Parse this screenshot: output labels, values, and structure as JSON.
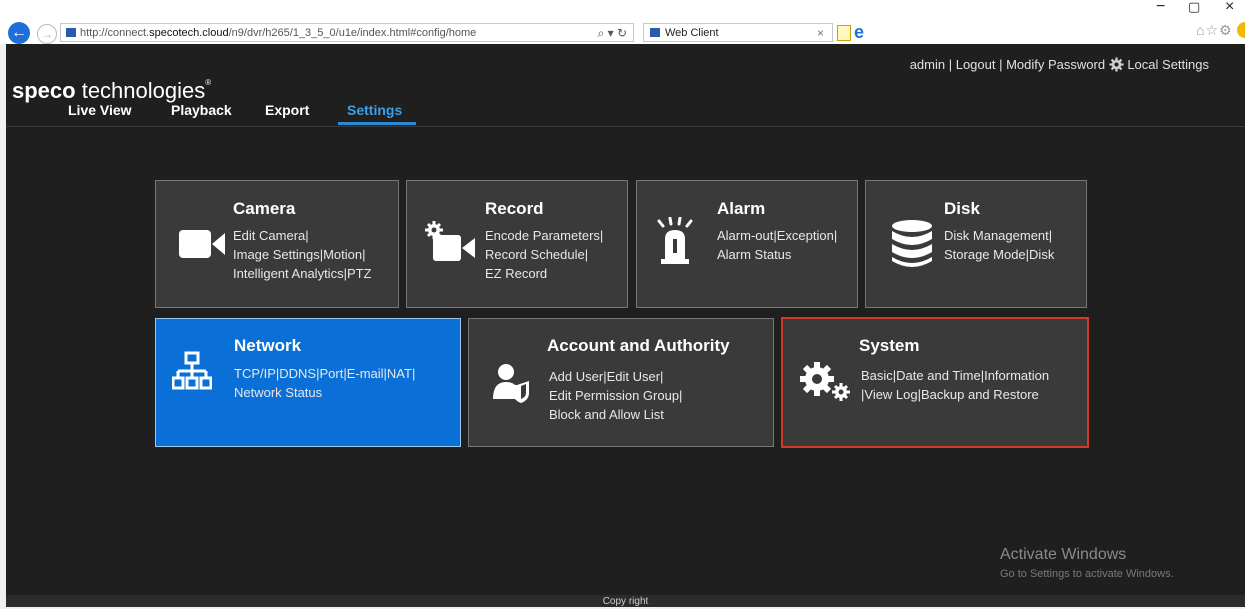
{
  "browser": {
    "url_prefix": "http://connect.",
    "url_domain": "specotech.cloud",
    "url_suffix": "/n9/dvr/h265/1_3_5_0/u1e/index.html#config/home",
    "address_controls": "⌕ ▾ ↻",
    "tab_title": "Web Client",
    "back_glyph": "←",
    "fwd_glyph": "→",
    "tab_close": "×",
    "tools": "⌂☆⚙",
    "window_controls": [
      "−",
      "▢",
      "×"
    ]
  },
  "app": {
    "logo_bold": "speco",
    "logo_rest": " technologies",
    "logo_reg": "®",
    "nav": [
      "Live View",
      "Playback",
      "Export",
      "Settings"
    ],
    "active_nav": "Settings",
    "user": {
      "admin": "admin",
      "sep1": " | ",
      "logout": "Logout",
      "sep2": "  |  ",
      "modify_password": "Modify Password",
      "local_settings": "Local Settings"
    }
  },
  "tiles": {
    "camera": {
      "title": "Camera",
      "lines": [
        "Edit Camera|",
        "Image Settings|Motion|",
        "Intelligent Analytics|PTZ"
      ]
    },
    "record": {
      "title": "Record",
      "lines": [
        "Encode Parameters|",
        "Record Schedule|",
        "EZ Record"
      ]
    },
    "alarm": {
      "title": "Alarm",
      "lines": [
        "Alarm-out|Exception|",
        "Alarm Status"
      ]
    },
    "disk": {
      "title": "Disk",
      "lines": [
        "Disk Management|",
        "Storage Mode|Disk"
      ]
    },
    "network": {
      "title": "Network",
      "lines": [
        "TCP/IP|DDNS|Port|E-mail|NAT|",
        "Network Status"
      ]
    },
    "account": {
      "title": "Account and Authority",
      "lines": [
        "Add User|Edit User|",
        "Edit Permission Group|",
        "Block and Allow List"
      ]
    },
    "system": {
      "title": "System",
      "lines": [
        "Basic|Date and Time|Information",
        "|View Log|Backup and Restore"
      ]
    }
  },
  "watermark": {
    "line1": "Activate Windows",
    "line2": "Go to Settings to activate Windows."
  },
  "footer": "Copy right",
  "colors": {
    "app_bg": "#1f1f1f",
    "tile_bg": "#3a3a3a",
    "network_tile": "#0a6fd6",
    "active_nav": "#3aa0e8",
    "system_highlight": "#d63a1e"
  },
  "icons": {
    "camera": "video-camera-icon",
    "record": "record-gear-camera-icon",
    "alarm": "alarm-siren-icon",
    "disk": "database-icon",
    "network": "network-tree-icon",
    "account": "user-shield-icon",
    "system": "gears-icon"
  }
}
